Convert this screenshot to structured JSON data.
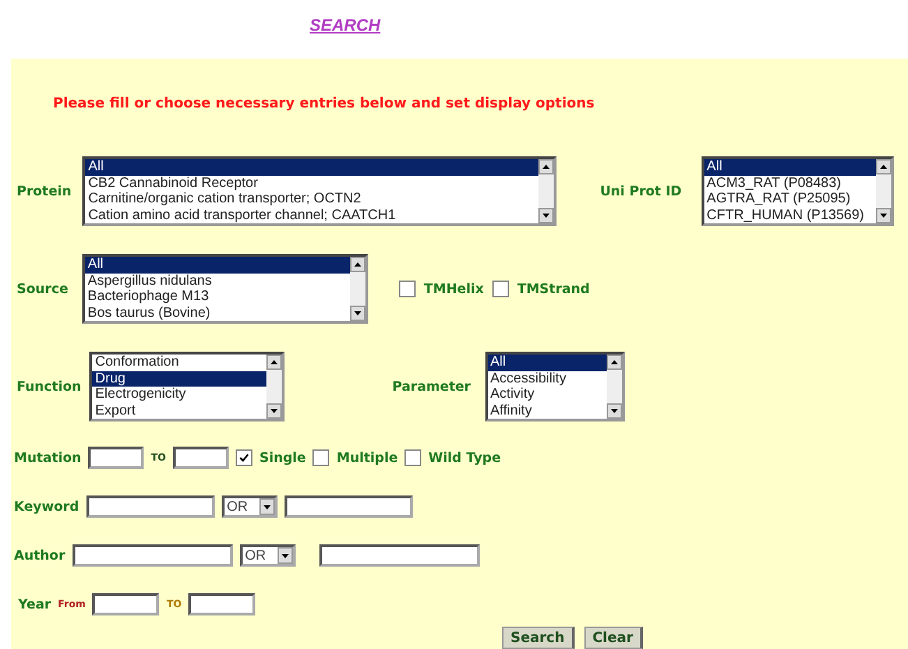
{
  "title": "SEARCH",
  "message": "Please fill or choose necessary entries below and set display options",
  "protein": {
    "label": "Protein",
    "items": [
      {
        "text": "All",
        "selected": true
      },
      {
        "text": "CB2 Cannabinoid Receptor",
        "selected": false
      },
      {
        "text": "Carnitine/organic cation transporter; OCTN2",
        "selected": false
      },
      {
        "text": "Cation amino acid transporter channel; CAATCH1",
        "selected": false
      }
    ]
  },
  "uniprot": {
    "label": "Uni Prot ID",
    "items": [
      {
        "text": "All",
        "selected": true
      },
      {
        "text": "ACM3_RAT (P08483)",
        "selected": false
      },
      {
        "text": "AGTRA_RAT (P25095)",
        "selected": false
      },
      {
        "text": "CFTR_HUMAN (P13569)",
        "selected": false
      }
    ]
  },
  "source": {
    "label": "Source",
    "items": [
      {
        "text": "All",
        "selected": true
      },
      {
        "text": "Aspergillus nidulans",
        "selected": false
      },
      {
        "text": "Bacteriophage M13",
        "selected": false
      },
      {
        "text": "Bos taurus (Bovine)",
        "selected": false
      }
    ]
  },
  "structure_checks": [
    {
      "label": "TMHelix",
      "checked": false
    },
    {
      "label": "TMStrand",
      "checked": false
    }
  ],
  "function": {
    "label": "Function",
    "items": [
      {
        "text": "Conformation",
        "selected": false
      },
      {
        "text": "Drug",
        "selected": true
      },
      {
        "text": "Electrogenicity",
        "selected": false
      },
      {
        "text": "Export",
        "selected": false
      }
    ]
  },
  "parameter": {
    "label": "Parameter",
    "items": [
      {
        "text": "All",
        "selected": true
      },
      {
        "text": "Accessibility",
        "selected": false
      },
      {
        "text": "Activity",
        "selected": false
      },
      {
        "text": "Affinity",
        "selected": false
      }
    ]
  },
  "mutation": {
    "label": "Mutation",
    "to": "TO",
    "checks": [
      {
        "label": "Single",
        "checked": true
      },
      {
        "label": "Multiple",
        "checked": false
      },
      {
        "label": "Wild Type",
        "checked": false
      }
    ]
  },
  "keyword": {
    "label": "Keyword",
    "operator": "OR"
  },
  "author": {
    "label": "Author",
    "operator": "OR"
  },
  "year": {
    "label": "Year",
    "from": "From",
    "to": "TO"
  },
  "buttons": [
    "Search",
    "Clear"
  ]
}
